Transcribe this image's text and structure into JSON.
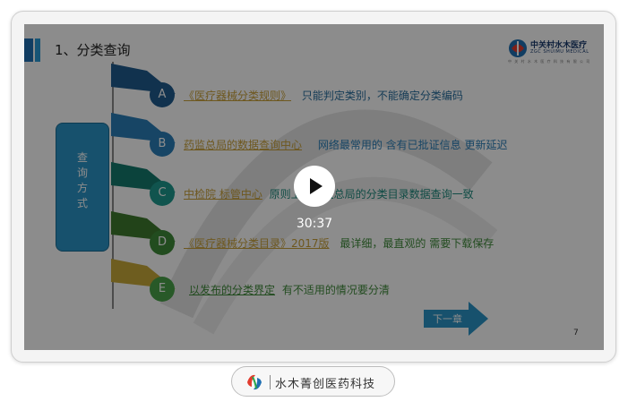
{
  "slide": {
    "title": "1、分类查询",
    "logo": {
      "name_cn": "中关村水木医疗",
      "name_en": "ZGC SHUIMU MEDICAL",
      "tagline": "中 关 村 水 木 医 疗 科 技 有 限 公 司"
    },
    "pill_label": [
      "查",
      "询",
      "方",
      "式"
    ],
    "rows": [
      {
        "letter": "A",
        "link": "《医疗器械分类规则》",
        "text": "只能判定类别，不能确定分类编码",
        "color": "#2a7fb8"
      },
      {
        "letter": "B",
        "link": "药监总局的数据查询中心",
        "text": "网络最常用的  含有已批证信息 更新延迟",
        "color": "#2a8fc4"
      },
      {
        "letter": "C",
        "link": "中检院 标管中心",
        "text": "原则上与药监总局的分类目录数据查询一致",
        "color": "#1e9a8e"
      },
      {
        "letter": "D",
        "link": "《医疗器械分类目录》2017版",
        "text": "最详细，最直观的  需要下载保存",
        "color": "#3f8a3a"
      },
      {
        "letter": "E",
        "link": "以发布的分类界定",
        "text": "有不适用的情况要分清",
        "color": "#4aa24a"
      }
    ],
    "next_label": "下一章",
    "page_number": "7"
  },
  "player": {
    "time": "30:37"
  },
  "brand": {
    "label": "水木菁创医药科技"
  },
  "colors": {
    "accent": "#2b94c7",
    "link": "#c9a13a",
    "chev_a": "#1f5c8f",
    "chev_b": "#2a7fb8",
    "chev_c": "#147a6e",
    "chev_d": "#3f7a2e",
    "chev_e": "#c9a93a"
  }
}
